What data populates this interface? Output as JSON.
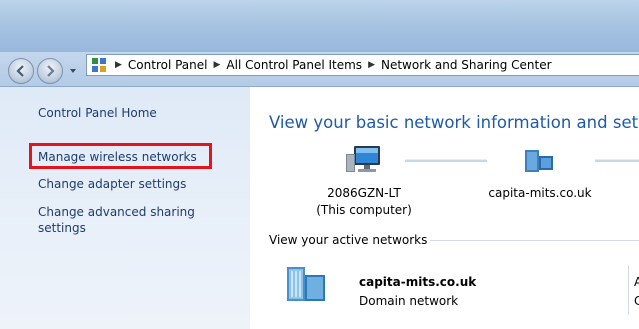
{
  "window": {
    "nav": {
      "back_icon": "back-arrow-icon",
      "forward_icon": "forward-arrow-icon",
      "dropdown_icon": "chevron-down-icon"
    },
    "breadcrumb": {
      "icon": "control-panel-icon",
      "items": [
        "Control Panel",
        "All Control Panel Items",
        "Network and Sharing Center"
      ]
    }
  },
  "sidebar": {
    "home": "Control Panel Home",
    "links": [
      {
        "label": "Manage wireless networks",
        "highlighted": true
      },
      {
        "label": "Change adapter settings"
      },
      {
        "label": "Change advanced sharing\nsettings"
      }
    ]
  },
  "main": {
    "title": "View your basic network information and set u",
    "map": {
      "computer_name": "2086GZN-LT",
      "computer_caption": "(This computer)",
      "network_name": "capita-mits.co.uk"
    },
    "active_networks": {
      "heading": "View your active networks",
      "network": {
        "name": "capita-mits.co.uk",
        "type": "Domain network"
      },
      "clipped_right": [
        "A",
        "C"
      ]
    }
  },
  "colors": {
    "highlight_border": "#e3141d",
    "link": "#1e3d6b",
    "title": "#1e5aa8"
  }
}
